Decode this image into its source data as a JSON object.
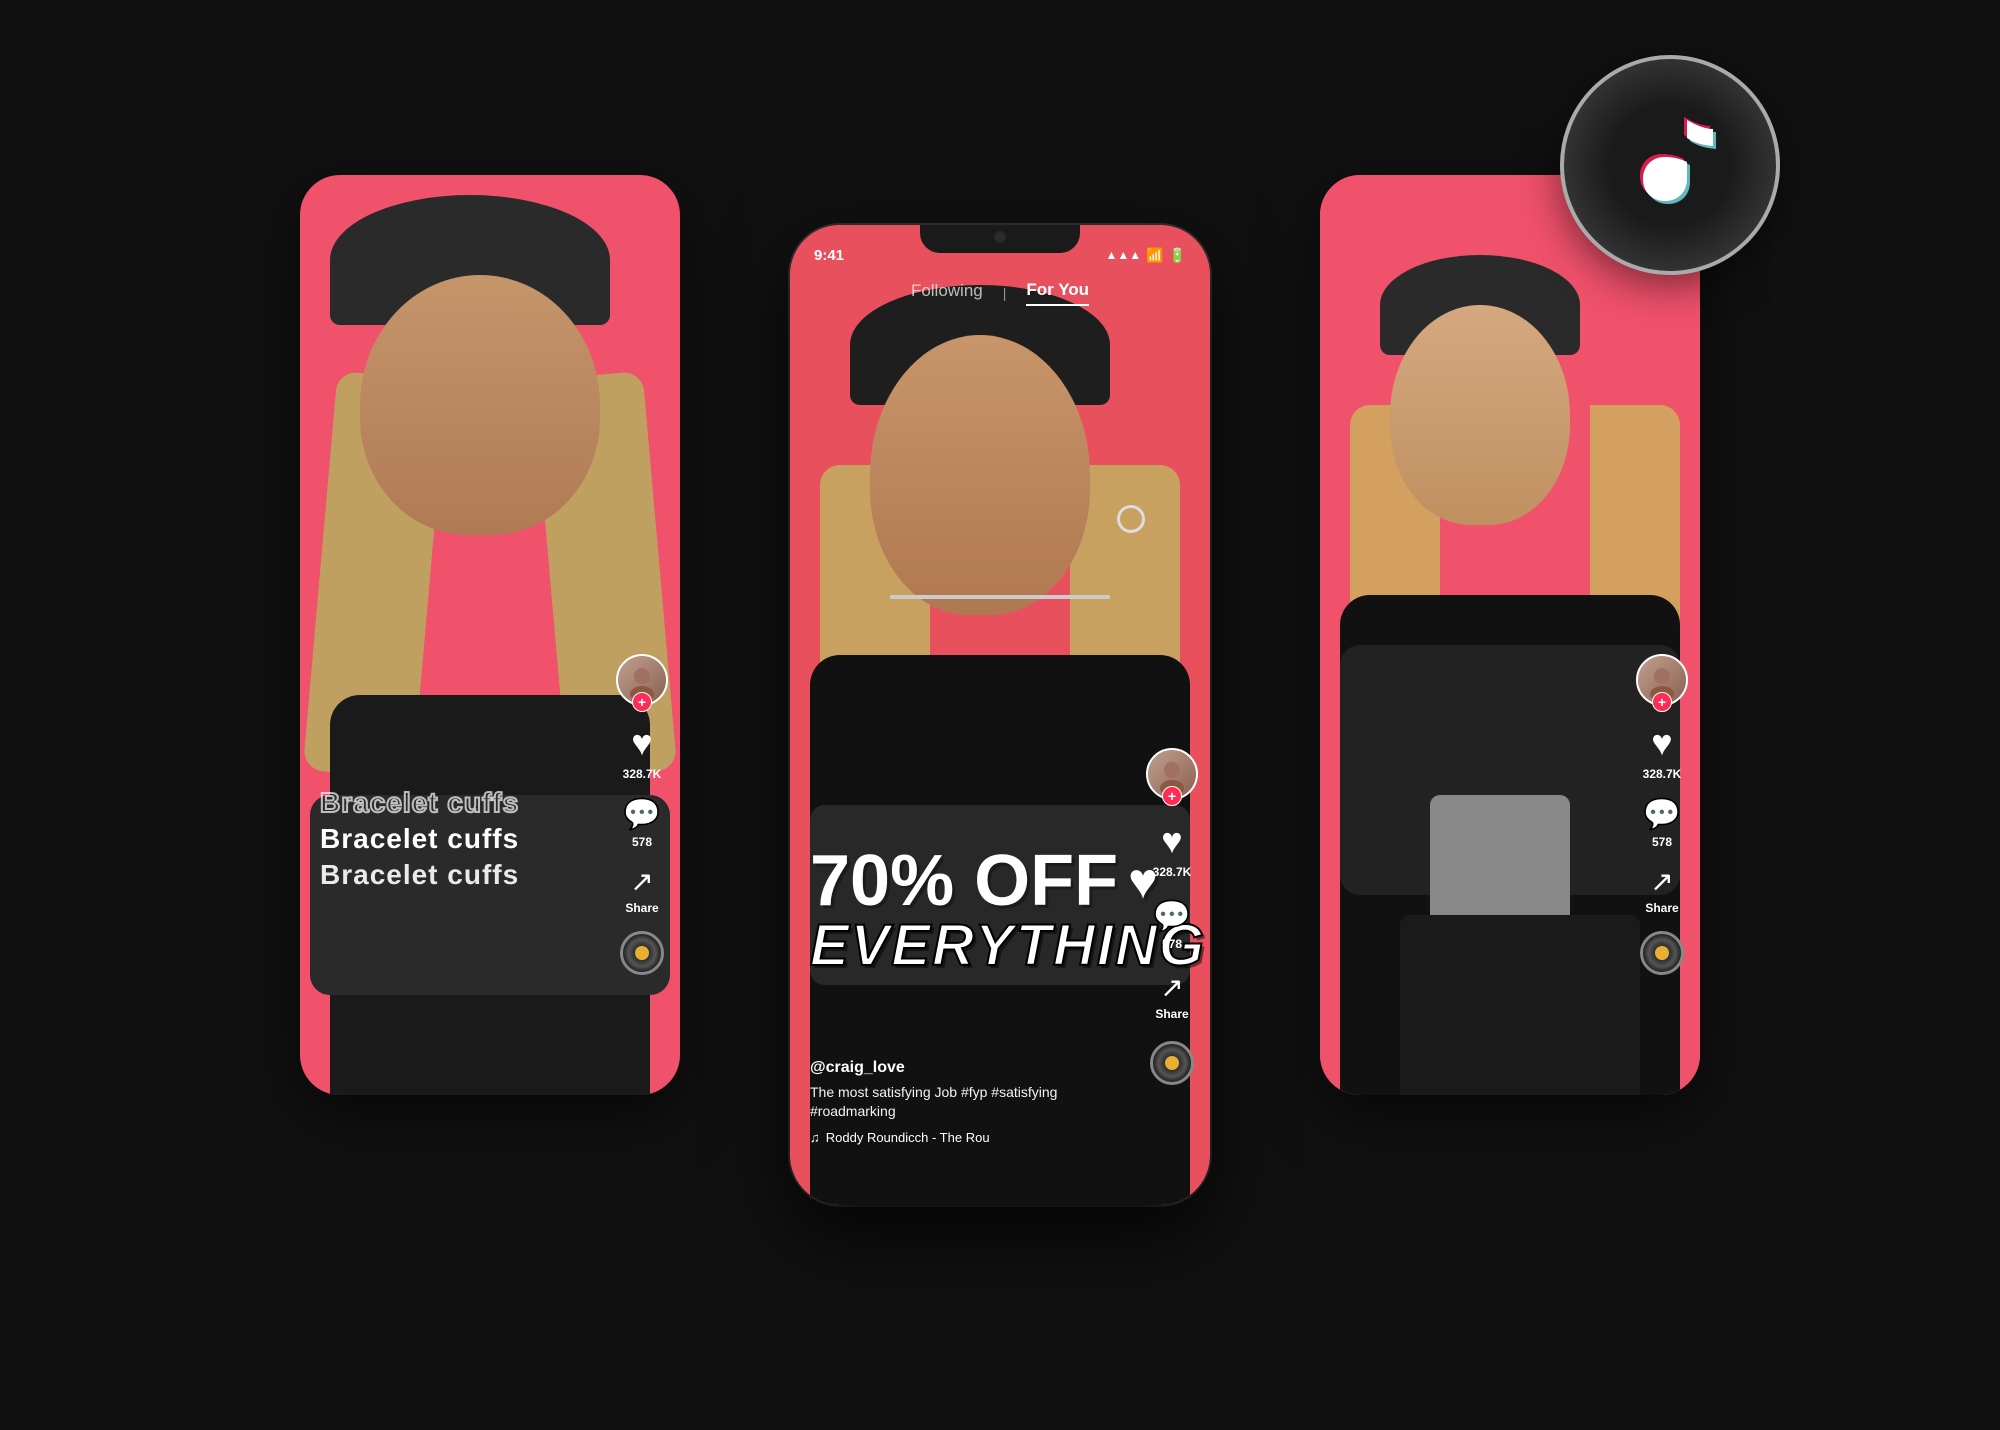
{
  "scene": {
    "background_color": "#111"
  },
  "phone_center": {
    "status_bar": {
      "time": "9:41",
      "signal_icon": "▲▲▲",
      "wifi_icon": "wifi",
      "battery_icon": "battery"
    },
    "nav": {
      "following_label": "Following",
      "divider": "|",
      "for_you_label": "For You",
      "active_tab": "for_you"
    },
    "content": {
      "promo_line1": "70% OFF",
      "promo_heart": "♥",
      "promo_line2": "EVERYTHING",
      "username": "@craig_love",
      "caption_text": "The most satisfying Job #fyp #satisfying #roadmarking",
      "hashtags": [
        "#fyp",
        "#satisfying",
        "#roadmarking"
      ],
      "music_note": "♫",
      "music_text": "Roddy Roundicch - The Rou"
    },
    "sidebar": {
      "plus_label": "+",
      "like_icon": "♥",
      "like_count": "328.7K",
      "comment_icon": "💬",
      "comment_count": "578",
      "share_icon": "➤",
      "share_label": "Share"
    }
  },
  "phone_left": {
    "overlay_texts": [
      "Bracelet cuffs",
      "Bracelet cuffs",
      "Bracelet cuffs"
    ],
    "sidebar": {
      "like_count": "328.7K",
      "comment_count": "578",
      "share_label": "Share"
    }
  },
  "phone_right": {
    "sidebar": {
      "like_count": "328.7K",
      "comment_count": "578",
      "share_label": "Share"
    }
  },
  "tiktok_logo": {
    "label": "TikTok"
  }
}
